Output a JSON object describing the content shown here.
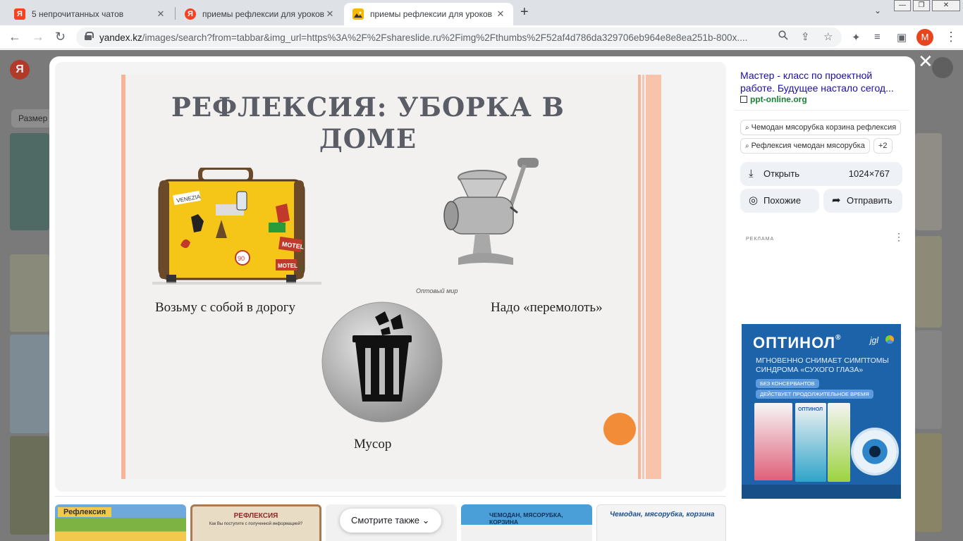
{
  "browser": {
    "tabs": [
      {
        "title": "5 непрочитанных чатов",
        "icon": "yandex-messenger-icon",
        "color": "#fc3f1d"
      },
      {
        "title": "приемы рефлексии для уроков фи",
        "icon": "yandex-icon",
        "color": "#fc3f1d"
      },
      {
        "title": "приемы рефлексии для уроков фи",
        "icon": "image-icon",
        "color": "#f9b700"
      }
    ],
    "active_tab": 2,
    "url_host": "yandex.kz",
    "url_path": "/images/search?from=tabbar&img_url=https%3A%2F%2Fshareslide.ru%2Fimg%2Fthumbs%2F52af4d786da329706eb964e8e8ea251b-800x....",
    "profile_initial": "M",
    "profile_color": "#e8451e"
  },
  "page_behind": {
    "logo": "Я",
    "size_filter": "Размер ▾"
  },
  "viewer": {
    "slide": {
      "title": "РЕФЛЕКСИЯ: УБОРКА В ДОМЕ",
      "captions": {
        "suitcase": "Возьму с собой в дорогу",
        "grinder": "Надо «перемолоть»",
        "trash": "Мусор"
      },
      "watermark": "Оптовый мир",
      "suitcase_stickers": [
        "VENEZIA",
        "MOTEL",
        "MOTEL",
        "90"
      ],
      "colors": {
        "accent_stripe": "#f4b59a",
        "dot": "#f28c38",
        "suitcase": "#f5c518"
      }
    },
    "source": {
      "title": "Мастер - класс по проектной работе. Будущее настало сегод...",
      "host": "ppt-online.org"
    },
    "related_chips": [
      "Чемодан мясорубка корзина рефлексия",
      "Рефлексия чемодан мясорубка",
      "+2"
    ],
    "download": {
      "label": "Открыть",
      "dimensions": "1024×767"
    },
    "similar_label": "Похожие",
    "share_label": "Отправить",
    "ad": {
      "label": "РЕКЛАМА",
      "brand": "ОПТИНОЛ",
      "registered": "®",
      "maker": "jgl",
      "headline": "МГНОВЕННО СНИМАЕТ СИМПТОМЫ СИНДРОМА «СУХОГО ГЛАЗА»",
      "badge_1": "БЕЗ КОНСЕРВАНТОВ",
      "badge_2": "ДЕЙСТВУЕТ ПРОДОЛЖИТЕЛЬНОЕ ВРЕМЯ",
      "box_label": "ОПТИНОЛ"
    },
    "thumbnails": [
      {
        "caption": "Рефлексия"
      },
      {
        "caption": "РЕФЛЕКСИЯ",
        "sub": "Как Вы поступите с полученной информацией?"
      },
      {
        "caption": ""
      },
      {
        "caption": "ЧЕМОДАН, МЯСОРУБКА, КОРЗИНА"
      },
      {
        "caption": "Чемодан, мясорубка, корзина"
      }
    ],
    "see_also_label": "Смотрите также"
  }
}
